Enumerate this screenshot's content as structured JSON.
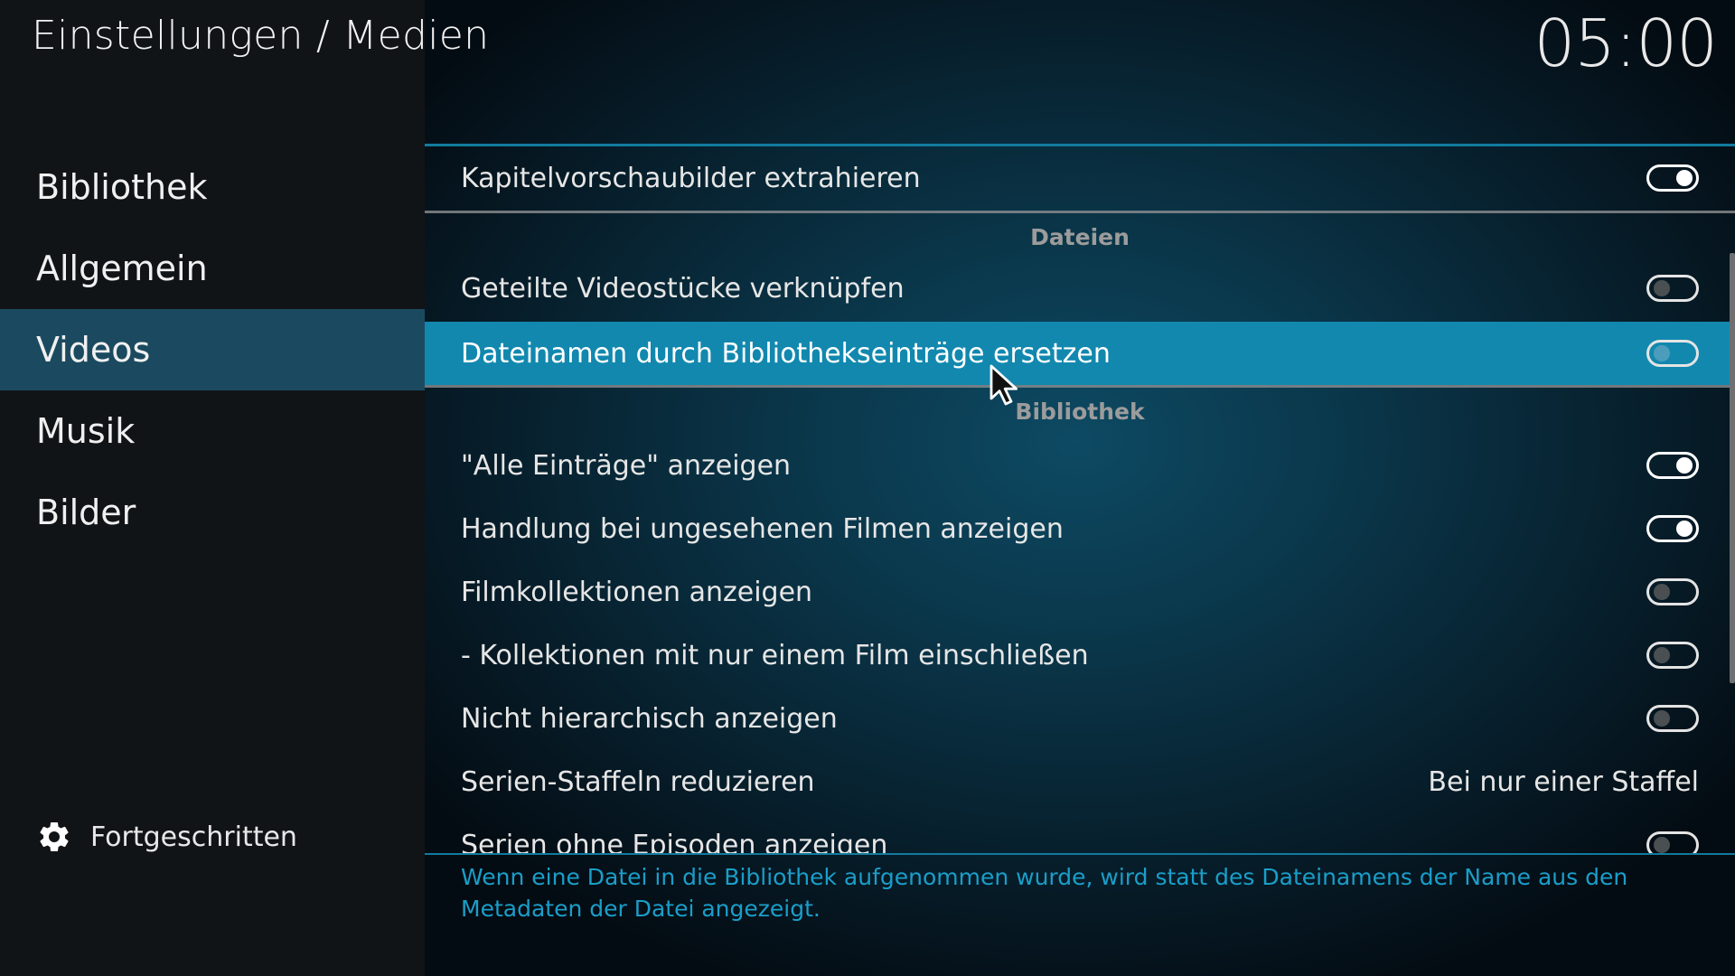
{
  "header": {
    "title": "Einstellungen / Medien",
    "clock": "05:00"
  },
  "sidebar": {
    "items": [
      {
        "label": "Bibliothek",
        "active": false
      },
      {
        "label": "Allgemein",
        "active": false
      },
      {
        "label": "Videos",
        "active": true
      },
      {
        "label": "Musik",
        "active": false
      },
      {
        "label": "Bilder",
        "active": false
      }
    ],
    "advanced_label": "Fortgeschritten"
  },
  "settings": {
    "row1": {
      "label": "Kapitelvorschaubilder extrahieren",
      "toggle": "on"
    },
    "section_files": "Dateien",
    "row2": {
      "label": "Geteilte Videostücke verknüpfen",
      "toggle": "off"
    },
    "row3": {
      "label": "Dateinamen durch Bibliothekseinträge ersetzen",
      "toggle": "off",
      "focused": true
    },
    "section_library": "Bibliothek",
    "row4": {
      "label": "\"Alle Einträge\" anzeigen",
      "toggle": "on"
    },
    "row5": {
      "label": "Handlung bei ungesehenen Filmen anzeigen",
      "toggle": "on"
    },
    "row6": {
      "label": "Filmkollektionen anzeigen",
      "toggle": "off"
    },
    "row7": {
      "label": "- Kollektionen mit nur einem Film einschließen",
      "toggle": "off"
    },
    "row8": {
      "label": "Nicht hierarchisch anzeigen",
      "toggle": "off"
    },
    "row9": {
      "label": "Serien-Staffeln reduzieren",
      "value": "Bei nur einer Staffel"
    },
    "row10": {
      "label": "Serien ohne Episoden anzeigen",
      "toggle": "off"
    }
  },
  "help_text": "Wenn eine Datei in die Bibliothek aufgenommen wurde, wird statt des Dateinamens der Name aus den Metadaten der Datei angezeigt.",
  "colors": {
    "accent": "#1288af",
    "help_text": "#1a9ec9",
    "sidebar_active": "#1b4a60"
  },
  "icons": {
    "advanced": "gear-icon",
    "pointer": "mouse-cursor-icon"
  }
}
